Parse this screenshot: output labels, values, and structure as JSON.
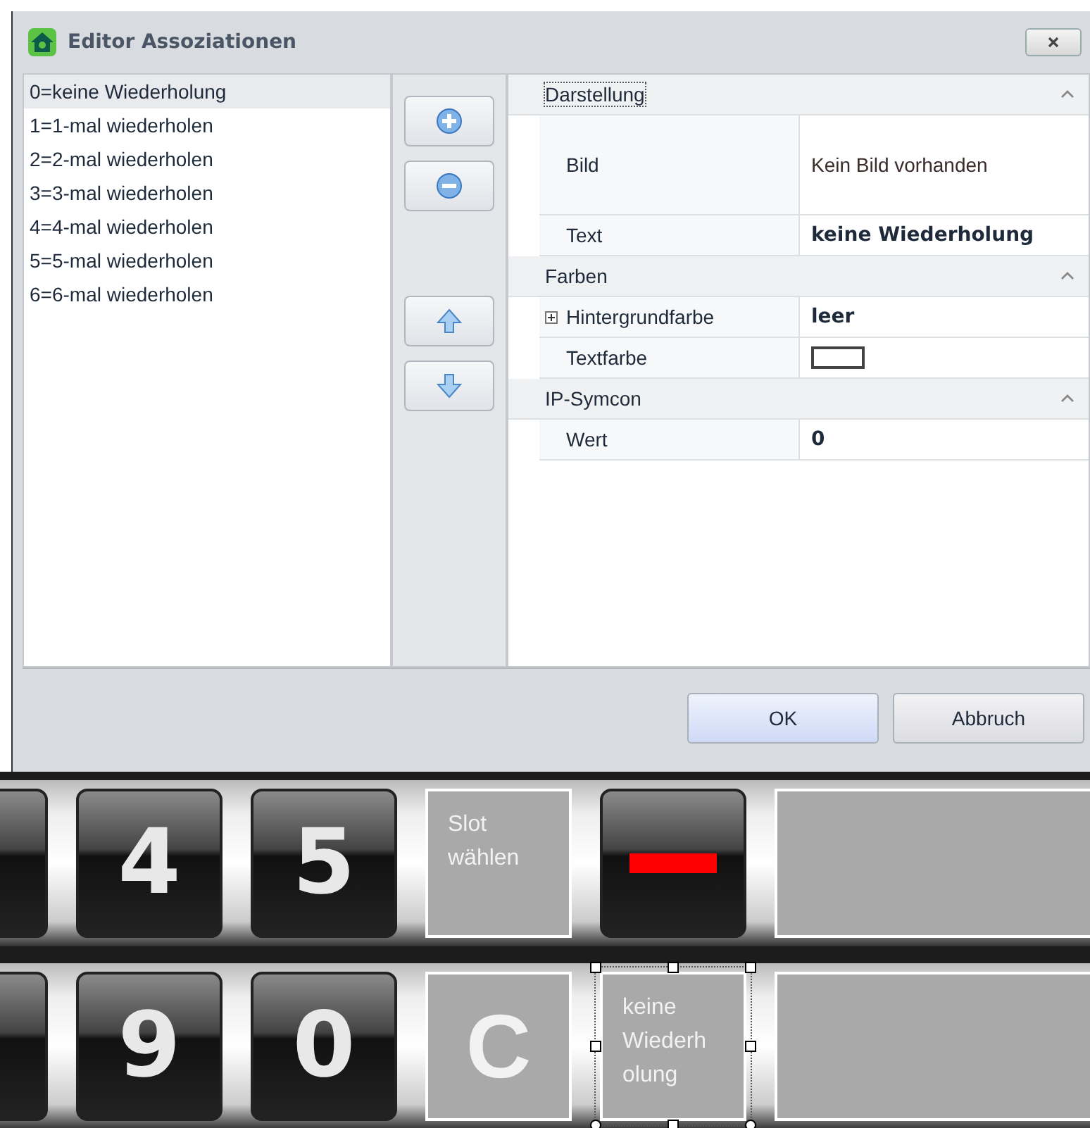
{
  "window": {
    "title": "Editor Assoziationen"
  },
  "list": {
    "items": [
      {
        "label": "0=keine Wiederholung",
        "selected": true
      },
      {
        "label": "1=1-mal wiederholen",
        "selected": false
      },
      {
        "label": "2=2-mal wiederholen",
        "selected": false
      },
      {
        "label": "3=3-mal wiederholen",
        "selected": false
      },
      {
        "label": "4=4-mal wiederholen",
        "selected": false
      },
      {
        "label": "5=5-mal wiederholen",
        "selected": false
      },
      {
        "label": "6=6-mal wiederholen",
        "selected": false
      }
    ]
  },
  "property_grid": {
    "categories": [
      {
        "name": "Darstellung",
        "expanded": true,
        "focused": true,
        "rows": [
          {
            "label": "Bild",
            "kind": "image",
            "value": "Kein Bild vorhanden",
            "expandable": false
          },
          {
            "label": "Text",
            "kind": "bold",
            "value": "keine Wiederholung",
            "expandable": false
          }
        ]
      },
      {
        "name": "Farben",
        "expanded": true,
        "focused": false,
        "rows": [
          {
            "label": "Hintergrundfarbe",
            "kind": "bold",
            "value": "leer",
            "expandable": true
          },
          {
            "label": "Textfarbe",
            "kind": "swatch",
            "expandable": false
          }
        ]
      },
      {
        "name": "IP-Symcon",
        "expanded": true,
        "focused": false,
        "rows": [
          {
            "label": "Wert",
            "kind": "bold",
            "value": "0",
            "expandable": false
          }
        ]
      }
    ]
  },
  "buttons": [
    {
      "label": "OK",
      "default": true
    },
    {
      "label": "Abbruch",
      "default": false
    }
  ],
  "designer": {
    "rows": [
      {
        "tiles": [
          {
            "kind": "edge",
            "selected": false
          },
          {
            "kind": "key",
            "label": "4",
            "selected": false
          },
          {
            "kind": "key",
            "label": "5",
            "selected": false
          },
          {
            "kind": "panel",
            "label": "Slot wählen",
            "selected": false
          },
          {
            "kind": "minus",
            "selected": false
          },
          {
            "kind": "empty",
            "selected": false
          }
        ]
      },
      {
        "tiles": [
          {
            "kind": "edge",
            "selected": false
          },
          {
            "kind": "key",
            "label": "9",
            "selected": false
          },
          {
            "kind": "key",
            "label": "0",
            "selected": false
          },
          {
            "kind": "letter",
            "label": "C",
            "selected": false
          },
          {
            "kind": "panel",
            "label": "keine Wiederholung",
            "selected": true
          },
          {
            "kind": "empty",
            "selected": false
          }
        ]
      }
    ]
  }
}
